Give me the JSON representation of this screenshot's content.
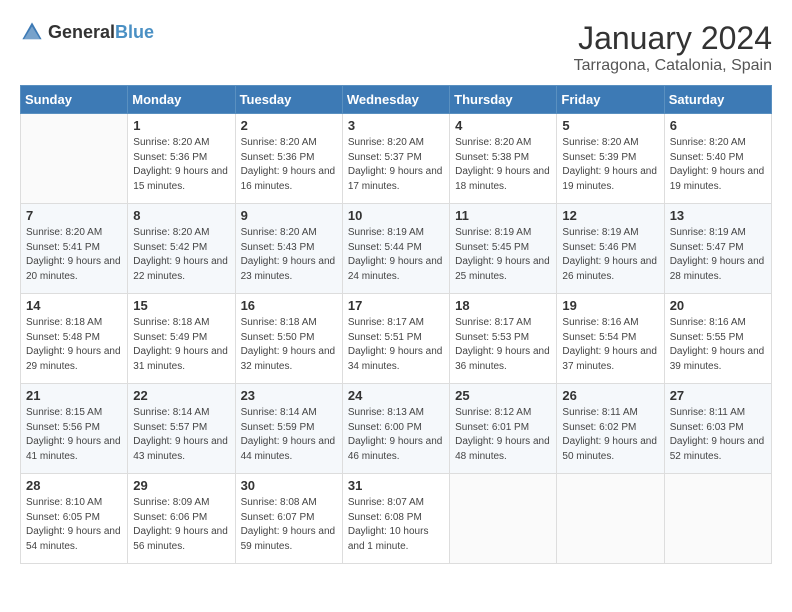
{
  "header": {
    "logo_general": "General",
    "logo_blue": "Blue",
    "month": "January 2024",
    "location": "Tarragona, Catalonia, Spain"
  },
  "days_of_week": [
    "Sunday",
    "Monday",
    "Tuesday",
    "Wednesday",
    "Thursday",
    "Friday",
    "Saturday"
  ],
  "weeks": [
    [
      {
        "day": "",
        "sunrise": "",
        "sunset": "",
        "daylight": ""
      },
      {
        "day": "1",
        "sunrise": "Sunrise: 8:20 AM",
        "sunset": "Sunset: 5:36 PM",
        "daylight": "Daylight: 9 hours and 15 minutes."
      },
      {
        "day": "2",
        "sunrise": "Sunrise: 8:20 AM",
        "sunset": "Sunset: 5:36 PM",
        "daylight": "Daylight: 9 hours and 16 minutes."
      },
      {
        "day": "3",
        "sunrise": "Sunrise: 8:20 AM",
        "sunset": "Sunset: 5:37 PM",
        "daylight": "Daylight: 9 hours and 17 minutes."
      },
      {
        "day": "4",
        "sunrise": "Sunrise: 8:20 AM",
        "sunset": "Sunset: 5:38 PM",
        "daylight": "Daylight: 9 hours and 18 minutes."
      },
      {
        "day": "5",
        "sunrise": "Sunrise: 8:20 AM",
        "sunset": "Sunset: 5:39 PM",
        "daylight": "Daylight: 9 hours and 19 minutes."
      },
      {
        "day": "6",
        "sunrise": "Sunrise: 8:20 AM",
        "sunset": "Sunset: 5:40 PM",
        "daylight": "Daylight: 9 hours and 19 minutes."
      }
    ],
    [
      {
        "day": "7",
        "sunrise": "Sunrise: 8:20 AM",
        "sunset": "Sunset: 5:41 PM",
        "daylight": "Daylight: 9 hours and 20 minutes."
      },
      {
        "day": "8",
        "sunrise": "Sunrise: 8:20 AM",
        "sunset": "Sunset: 5:42 PM",
        "daylight": "Daylight: 9 hours and 22 minutes."
      },
      {
        "day": "9",
        "sunrise": "Sunrise: 8:20 AM",
        "sunset": "Sunset: 5:43 PM",
        "daylight": "Daylight: 9 hours and 23 minutes."
      },
      {
        "day": "10",
        "sunrise": "Sunrise: 8:19 AM",
        "sunset": "Sunset: 5:44 PM",
        "daylight": "Daylight: 9 hours and 24 minutes."
      },
      {
        "day": "11",
        "sunrise": "Sunrise: 8:19 AM",
        "sunset": "Sunset: 5:45 PM",
        "daylight": "Daylight: 9 hours and 25 minutes."
      },
      {
        "day": "12",
        "sunrise": "Sunrise: 8:19 AM",
        "sunset": "Sunset: 5:46 PM",
        "daylight": "Daylight: 9 hours and 26 minutes."
      },
      {
        "day": "13",
        "sunrise": "Sunrise: 8:19 AM",
        "sunset": "Sunset: 5:47 PM",
        "daylight": "Daylight: 9 hours and 28 minutes."
      }
    ],
    [
      {
        "day": "14",
        "sunrise": "Sunrise: 8:18 AM",
        "sunset": "Sunset: 5:48 PM",
        "daylight": "Daylight: 9 hours and 29 minutes."
      },
      {
        "day": "15",
        "sunrise": "Sunrise: 8:18 AM",
        "sunset": "Sunset: 5:49 PM",
        "daylight": "Daylight: 9 hours and 31 minutes."
      },
      {
        "day": "16",
        "sunrise": "Sunrise: 8:18 AM",
        "sunset": "Sunset: 5:50 PM",
        "daylight": "Daylight: 9 hours and 32 minutes."
      },
      {
        "day": "17",
        "sunrise": "Sunrise: 8:17 AM",
        "sunset": "Sunset: 5:51 PM",
        "daylight": "Daylight: 9 hours and 34 minutes."
      },
      {
        "day": "18",
        "sunrise": "Sunrise: 8:17 AM",
        "sunset": "Sunset: 5:53 PM",
        "daylight": "Daylight: 9 hours and 36 minutes."
      },
      {
        "day": "19",
        "sunrise": "Sunrise: 8:16 AM",
        "sunset": "Sunset: 5:54 PM",
        "daylight": "Daylight: 9 hours and 37 minutes."
      },
      {
        "day": "20",
        "sunrise": "Sunrise: 8:16 AM",
        "sunset": "Sunset: 5:55 PM",
        "daylight": "Daylight: 9 hours and 39 minutes."
      }
    ],
    [
      {
        "day": "21",
        "sunrise": "Sunrise: 8:15 AM",
        "sunset": "Sunset: 5:56 PM",
        "daylight": "Daylight: 9 hours and 41 minutes."
      },
      {
        "day": "22",
        "sunrise": "Sunrise: 8:14 AM",
        "sunset": "Sunset: 5:57 PM",
        "daylight": "Daylight: 9 hours and 43 minutes."
      },
      {
        "day": "23",
        "sunrise": "Sunrise: 8:14 AM",
        "sunset": "Sunset: 5:59 PM",
        "daylight": "Daylight: 9 hours and 44 minutes."
      },
      {
        "day": "24",
        "sunrise": "Sunrise: 8:13 AM",
        "sunset": "Sunset: 6:00 PM",
        "daylight": "Daylight: 9 hours and 46 minutes."
      },
      {
        "day": "25",
        "sunrise": "Sunrise: 8:12 AM",
        "sunset": "Sunset: 6:01 PM",
        "daylight": "Daylight: 9 hours and 48 minutes."
      },
      {
        "day": "26",
        "sunrise": "Sunrise: 8:11 AM",
        "sunset": "Sunset: 6:02 PM",
        "daylight": "Daylight: 9 hours and 50 minutes."
      },
      {
        "day": "27",
        "sunrise": "Sunrise: 8:11 AM",
        "sunset": "Sunset: 6:03 PM",
        "daylight": "Daylight: 9 hours and 52 minutes."
      }
    ],
    [
      {
        "day": "28",
        "sunrise": "Sunrise: 8:10 AM",
        "sunset": "Sunset: 6:05 PM",
        "daylight": "Daylight: 9 hours and 54 minutes."
      },
      {
        "day": "29",
        "sunrise": "Sunrise: 8:09 AM",
        "sunset": "Sunset: 6:06 PM",
        "daylight": "Daylight: 9 hours and 56 minutes."
      },
      {
        "day": "30",
        "sunrise": "Sunrise: 8:08 AM",
        "sunset": "Sunset: 6:07 PM",
        "daylight": "Daylight: 9 hours and 59 minutes."
      },
      {
        "day": "31",
        "sunrise": "Sunrise: 8:07 AM",
        "sunset": "Sunset: 6:08 PM",
        "daylight": "Daylight: 10 hours and 1 minute."
      },
      {
        "day": "",
        "sunrise": "",
        "sunset": "",
        "daylight": ""
      },
      {
        "day": "",
        "sunrise": "",
        "sunset": "",
        "daylight": ""
      },
      {
        "day": "",
        "sunrise": "",
        "sunset": "",
        "daylight": ""
      }
    ]
  ]
}
